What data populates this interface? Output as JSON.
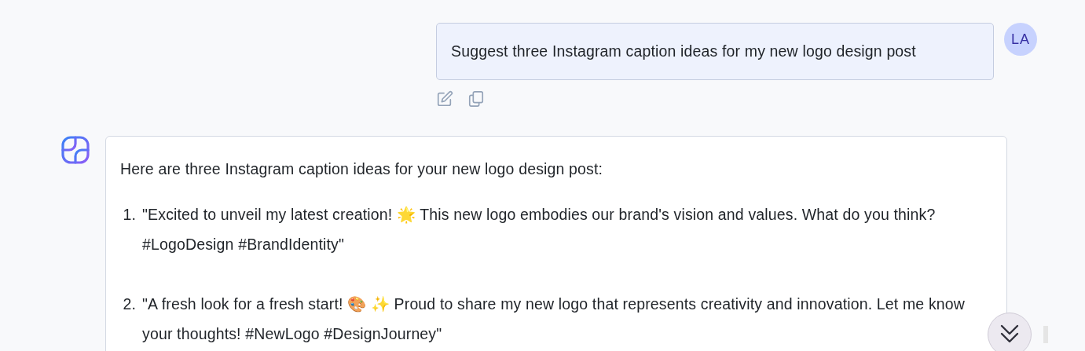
{
  "user_message": {
    "text": "Suggest three Instagram caption ideas for my new logo design post",
    "avatar": "LA"
  },
  "assistant_message": {
    "intro": "Here are three Instagram caption ideas for your new logo design post:",
    "items": [
      {
        "number": "1.",
        "text": "\"Excited to unveil my latest creation! 🌟 This new logo embodies our brand's vision and values. What do you think? #LogoDesign #BrandIdentity\""
      },
      {
        "number": "2.",
        "text": "\"A fresh look for a fresh start! 🎨 ✨ Proud to share my new logo that represents creativity and innovation. Let me know your thoughts! #NewLogo #DesignJourney\""
      }
    ]
  }
}
